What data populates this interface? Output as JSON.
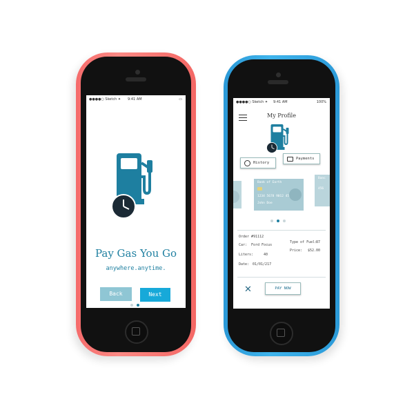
{
  "colors": {
    "accent": "#1e7fa0",
    "next_button": "#17a9d9",
    "back_button": "#8fc6d4",
    "card": "#a9cbd4",
    "phone_red": "#f56b6b",
    "phone_blue": "#2a98d6"
  },
  "left_phone": {
    "status": {
      "carrier": "●●●●○ Sketch ✦",
      "time": "9:41 AM",
      "battery": "▭"
    },
    "icons": [
      "gas-pump-icon",
      "clock-icon"
    ],
    "title": "Pay Gas You Go",
    "subtitle": "anywhere.anytime.",
    "back_label": "Back",
    "next_label": "Next",
    "page_indicator": {
      "count": 2,
      "active": 2
    }
  },
  "right_phone": {
    "status": {
      "carrier": "●●●●○ Sketch ✦",
      "time": "9:41 AM",
      "battery": "100%"
    },
    "title": "My Profile",
    "icons": [
      "menu-icon",
      "gas-pump-icon",
      "clock-icon"
    ],
    "history_label": "History",
    "payments_label": "Payments",
    "card": {
      "bank": "Bank of Earth",
      "number": "1234 5678 9012 4567",
      "holder": "John Doe"
    },
    "side_card_right": {
      "bank": "Banc",
      "number": "456"
    },
    "carousel_indicator": {
      "count": 3,
      "active": 2
    },
    "order": {
      "order_no": "Order #91112",
      "car_label": "Car:",
      "car_value": "Ford Focus",
      "liters_label": "Liters:",
      "liters_value": "40",
      "date_label": "Date:",
      "date_value": "01/01/217",
      "fuel_label": "Type of Fuel:",
      "fuel_value": "87",
      "price_label": "Price:",
      "price_value": "$52.00"
    },
    "close_icon": "✕",
    "pay_now_label": "PAY NOW"
  }
}
